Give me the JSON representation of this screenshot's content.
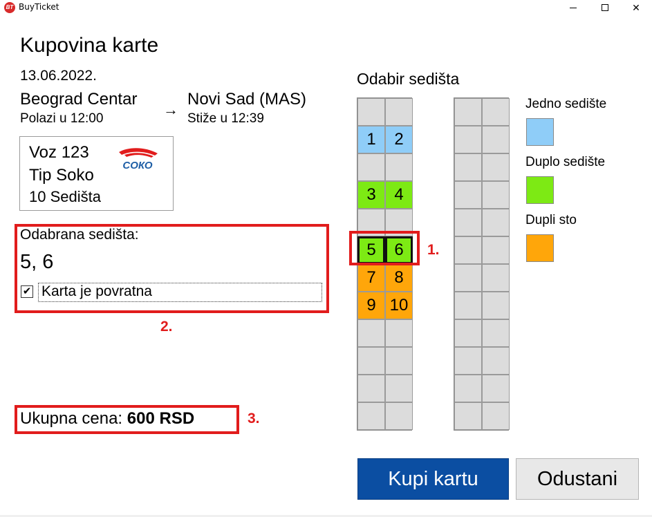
{
  "window": {
    "title": "BuyTicket",
    "logo_text": "BT"
  },
  "page": {
    "heading": "Kupovina karte"
  },
  "trip": {
    "date": "13.06.2022.",
    "from": "Beograd Centar",
    "departs": "Polazi u 12:00",
    "arrow": "→",
    "to": "Novi Sad (MAS)",
    "arrives": "Stiže u 12:39"
  },
  "train": {
    "number": "Voz 123",
    "type": "Tip Soko",
    "seats": "10 Sedišta",
    "logo_text": "СОКО",
    "logo_color": "#1f5fa6",
    "logo_accent": "#e11c1c"
  },
  "selection": {
    "label": "Odabrana sedišta:",
    "value": "5, 6",
    "return_checked": true,
    "return_label": "Karta je povratna"
  },
  "price": {
    "label": "Ukupna cena:",
    "value": "600 RSD"
  },
  "annotations": {
    "m1": "1.",
    "m2": "2.",
    "m3": "3."
  },
  "seat_map": {
    "title": "Odabir sedišta",
    "left_rows": [
      [
        {
          "n": "",
          "t": "empty"
        },
        {
          "n": "",
          "t": "empty"
        }
      ],
      [
        {
          "n": "1",
          "t": "jedno"
        },
        {
          "n": "2",
          "t": "jedno"
        }
      ],
      [
        {
          "n": "",
          "t": "empty"
        },
        {
          "n": "",
          "t": "empty"
        }
      ],
      [
        {
          "n": "3",
          "t": "duplo"
        },
        {
          "n": "4",
          "t": "duplo"
        }
      ],
      [
        {
          "n": "",
          "t": "empty"
        },
        {
          "n": "",
          "t": "empty"
        }
      ],
      [
        {
          "n": "5",
          "t": "duplo",
          "selected": true
        },
        {
          "n": "6",
          "t": "duplo",
          "selected": true
        }
      ],
      [
        {
          "n": "7",
          "t": "sto"
        },
        {
          "n": "8",
          "t": "sto"
        }
      ],
      [
        {
          "n": "9",
          "t": "sto"
        },
        {
          "n": "10",
          "t": "sto"
        }
      ],
      [
        {
          "n": "",
          "t": "empty"
        },
        {
          "n": "",
          "t": "empty"
        }
      ],
      [
        {
          "n": "",
          "t": "empty"
        },
        {
          "n": "",
          "t": "empty"
        }
      ],
      [
        {
          "n": "",
          "t": "empty"
        },
        {
          "n": "",
          "t": "empty"
        }
      ],
      [
        {
          "n": "",
          "t": "empty"
        },
        {
          "n": "",
          "t": "empty"
        }
      ]
    ],
    "right_rows": 12,
    "colors": {
      "jedno": "#8fcdf8",
      "duplo": "#7dea14",
      "sto": "#ffa60a",
      "empty": "#dcdcdc"
    }
  },
  "legend": [
    {
      "label": "Jedno sedište",
      "color": "#8fcdf8"
    },
    {
      "label": "Duplo sedište",
      "color": "#7dea14"
    },
    {
      "label": "Dupli sto",
      "color": "#ffa60a"
    }
  ],
  "buttons": {
    "buy": "Kupi kartu",
    "cancel": "Odustani"
  },
  "colors": {
    "accent": "#0b4ea2",
    "highlight": "#e11c1c"
  }
}
